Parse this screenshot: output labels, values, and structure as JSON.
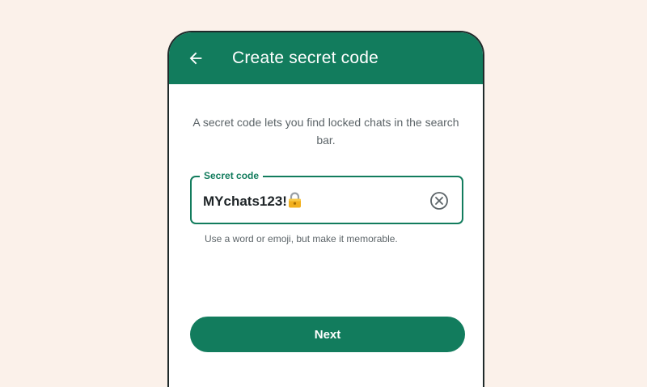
{
  "header": {
    "title": "Create secret code",
    "back_icon": "arrow-left-icon"
  },
  "description": "A secret code lets you find locked chats in the search bar.",
  "secret_field": {
    "label": "Secret code",
    "value": "MYchats123!",
    "value_emoji": "lock-emoji",
    "clear_icon": "clear-circle-x-icon"
  },
  "helper_text": "Use a word or emoji, but make it memorable.",
  "next_button": {
    "label": "Next"
  },
  "colors": {
    "accent": "#127c5d",
    "background": "#fbf1ea",
    "text_primary": "#1e2427",
    "text_secondary": "#5c6468"
  }
}
